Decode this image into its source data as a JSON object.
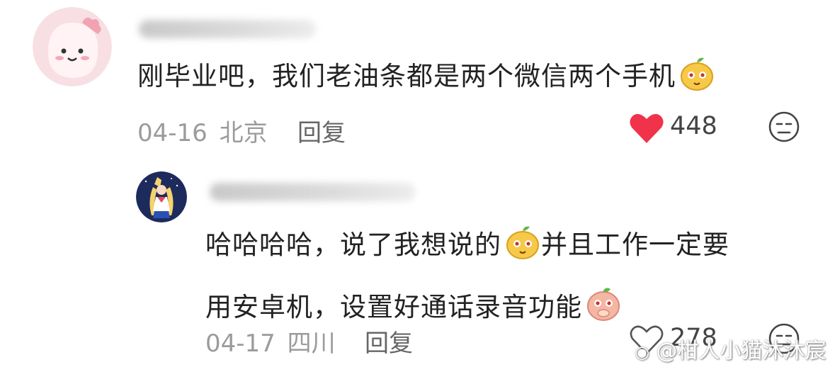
{
  "comment1": {
    "text": "刚毕业吧，我们老油条都是两个微信两个手机",
    "date": "04-16",
    "location": "北京",
    "reply_label": "回复",
    "likes": "448",
    "emoji": "yellow-mango-emoji"
  },
  "comment2": {
    "text_part1": "哈哈哈哈，说了我想说的",
    "text_part2": "并且工作一定要",
    "text_line2": "用安卓机，设置好通话录音功能",
    "date": "04-17",
    "location": "四川",
    "reply_label": "回复",
    "likes": "278",
    "emoji": "yellow-mango-emoji"
  },
  "watermark": "@柑人小猫沐沐宸",
  "colors": {
    "like": "#f0334a",
    "meta": "#9b9b9b",
    "text": "#222222"
  }
}
